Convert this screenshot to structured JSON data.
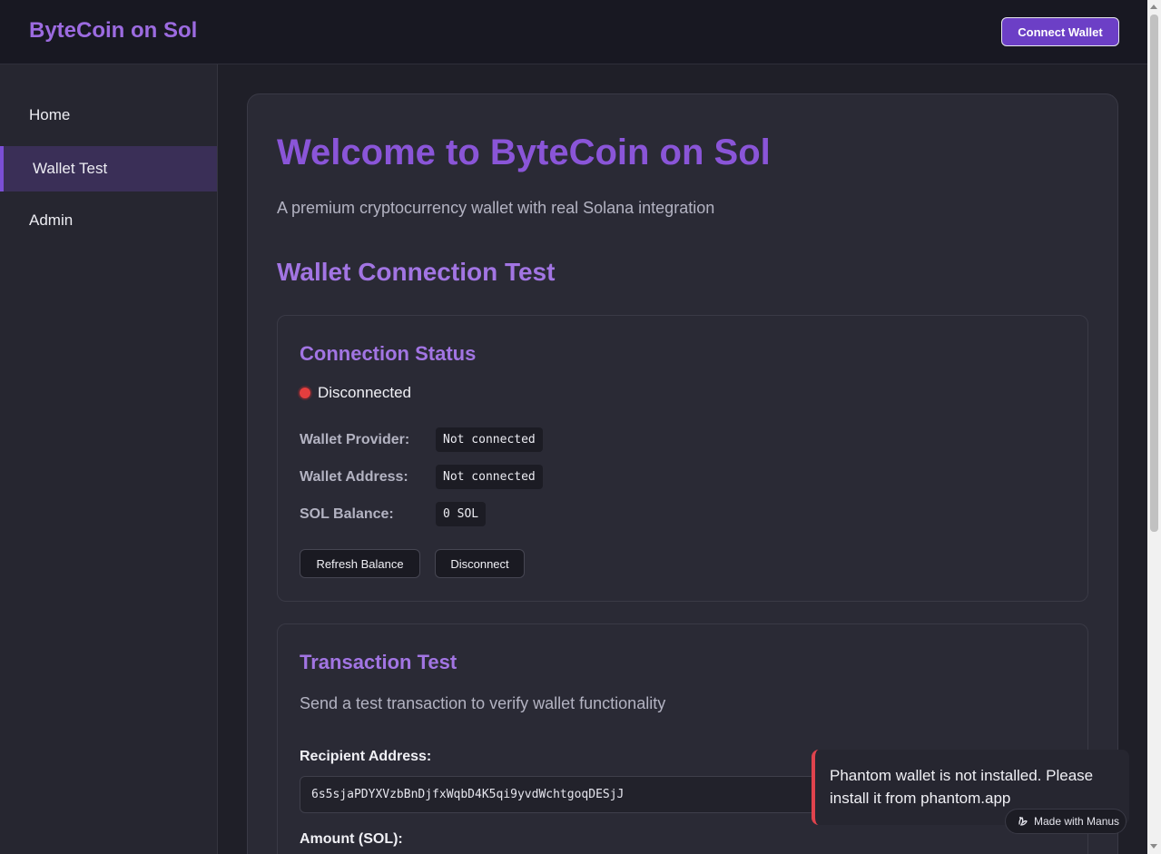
{
  "header": {
    "brand": "ByteCoin on Sol",
    "connect_label": "Connect Wallet"
  },
  "sidebar": {
    "items": [
      {
        "label": "Home"
      },
      {
        "label": "Wallet Test"
      },
      {
        "label": "Admin"
      }
    ],
    "active_index": 1
  },
  "main": {
    "title": "Welcome to ByteCoin on Sol",
    "subtitle": "A premium cryptocurrency wallet with real Solana integration",
    "section_title": "Wallet Connection Test",
    "connection": {
      "title": "Connection Status",
      "status": "Disconnected",
      "status_color": "#e53e3e",
      "rows": [
        {
          "label": "Wallet Provider:",
          "value": "Not connected"
        },
        {
          "label": "Wallet Address:",
          "value": "Not connected"
        },
        {
          "label": "SOL Balance:",
          "value": "0 SOL"
        }
      ],
      "refresh_label": "Refresh Balance",
      "disconnect_label": "Disconnect"
    },
    "transaction": {
      "title": "Transaction Test",
      "description": "Send a test transaction to verify wallet functionality",
      "recipient_label": "Recipient Address:",
      "recipient_value": "6s5sjaPDYXVzbBnDjfxWqbD4K5qi9yvdWchtgoqDESjJ",
      "amount_label": "Amount (SOL):"
    }
  },
  "toast": {
    "message": "Phantom wallet is not installed. Please install it from phantom.app",
    "accent": "#e0434d"
  },
  "badge": {
    "label": "Made with Manus",
    "icon": "manus-logo-icon"
  },
  "colors": {
    "accent": "#6c3fc6",
    "title": "#8a55d8"
  }
}
